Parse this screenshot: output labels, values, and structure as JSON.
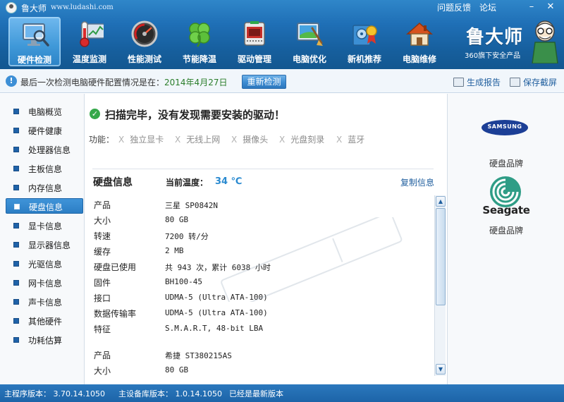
{
  "window": {
    "title": "鲁大师",
    "url": "www.ludashi.com",
    "feedback_label": "问题反馈",
    "forum_label": "论坛",
    "minimize_label": "–",
    "close_label": "✕"
  },
  "nav": {
    "items": [
      {
        "label": "硬件检测",
        "icon": "monitor-magnifier-icon",
        "active": true
      },
      {
        "label": "温度监测",
        "icon": "thermometer-icon"
      },
      {
        "label": "性能测试",
        "icon": "speedometer-icon"
      },
      {
        "label": "节能降温",
        "icon": "clover-icon"
      },
      {
        "label": "驱动管理",
        "icon": "driver-chip-icon"
      },
      {
        "label": "电脑优化",
        "icon": "broom-screen-icon"
      },
      {
        "label": "新机推荐",
        "icon": "hard-drive-award-icon"
      },
      {
        "label": "电脑维修",
        "icon": "house-wrench-icon"
      }
    ],
    "brand_name": "鲁大师",
    "brand_sub": "360旗下安全产品"
  },
  "infobar": {
    "prefix": "最后一次检测电脑硬件配置情况是在：",
    "date": "2014年4月27日",
    "recheck_label": "重新检测",
    "report_label": "生成报告",
    "screenshot_label": "保存截屏"
  },
  "sidebar": {
    "items": [
      {
        "label": "电脑概览"
      },
      {
        "label": "硬件健康"
      },
      {
        "label": "处理器信息"
      },
      {
        "label": "主板信息"
      },
      {
        "label": "内存信息"
      },
      {
        "label": "硬盘信息",
        "active": true
      },
      {
        "label": "显卡信息"
      },
      {
        "label": "显示器信息"
      },
      {
        "label": "光驱信息"
      },
      {
        "label": "网卡信息"
      },
      {
        "label": "声卡信息"
      },
      {
        "label": "其他硬件"
      },
      {
        "label": "功耗估算"
      }
    ]
  },
  "main": {
    "scan_title": "扫描完毕，没有发现需要安装的驱动！",
    "functions_label": "功能：",
    "x_mark": "X",
    "functions": [
      "独立显卡",
      "无线上网",
      "摄像头",
      "光盘刻录",
      "蓝牙"
    ],
    "section_title": "硬盘信息",
    "temp_label": "当前温度：",
    "temp_value": "34 ℃",
    "copy_label": "复制信息",
    "disk1": [
      {
        "key": "产品",
        "value": "三星 SP0842N"
      },
      {
        "key": "大小",
        "value": "80 GB"
      },
      {
        "key": "转速",
        "value": "7200 转/分"
      },
      {
        "key": "缓存",
        "value": "2 MB"
      },
      {
        "key": "硬盘已使用",
        "value": "共 943 次，累计 6038 小时"
      },
      {
        "key": "固件",
        "value": "BH100-45"
      },
      {
        "key": "接口",
        "value": "UDMA-5 (Ultra ATA-100)"
      },
      {
        "key": "数据传输率",
        "value": "UDMA-5 (Ultra ATA-100)"
      },
      {
        "key": "特征",
        "value": "S.M.A.R.T, 48-bit LBA"
      }
    ],
    "disk2": [
      {
        "key": "产品",
        "value": "希捷 ST380215AS"
      },
      {
        "key": "大小",
        "value": "80 GB"
      }
    ]
  },
  "right_panel": {
    "samsung_logo_text": "SAMSUNG",
    "caption1": "硬盘品牌",
    "seagate_logo_text": "Seagate",
    "caption2": "硬盘品牌"
  },
  "statusbar": {
    "program_version": "主程序版本： 3.70.14.1050",
    "device_db_version": "主设备库版本： 1.0.14.1050",
    "update_status": "已经是最新版本"
  },
  "colors": {
    "header_blue": "#1f6fb6",
    "accent_blue": "#2c7ec5",
    "date_green": "#2a7d2a",
    "temp_blue": "#2a8ad0"
  }
}
